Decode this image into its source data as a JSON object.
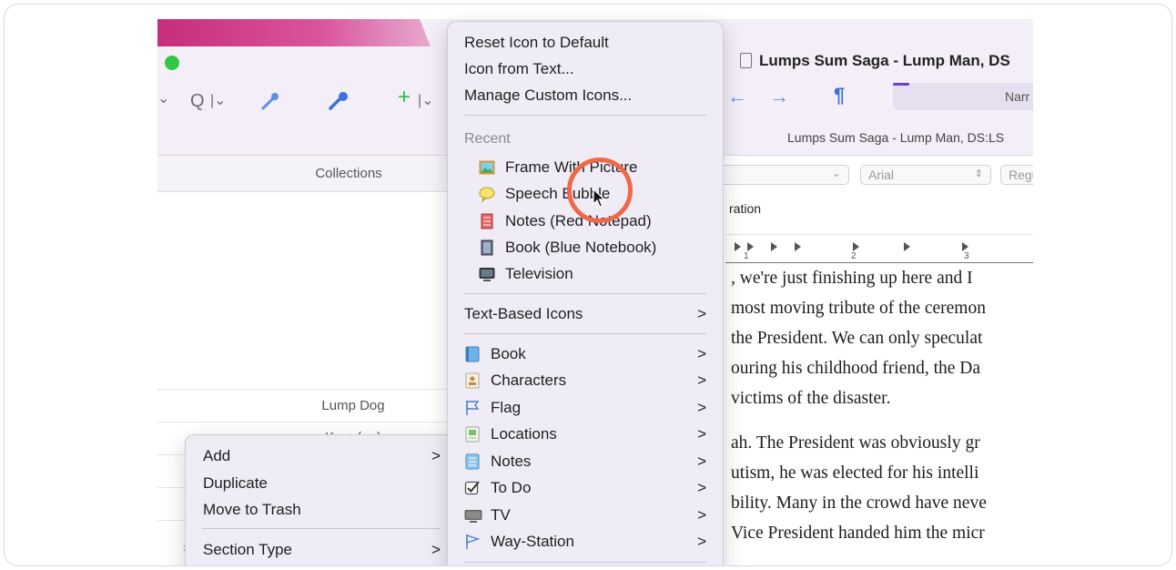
{
  "toolbar": {
    "collections_label": "Collections",
    "nav_back": "←",
    "nav_forward": "→",
    "pilcrow": "¶",
    "mode_pill": "Narr",
    "left_glyphs": {
      "chevron": "⌄",
      "search": "Q",
      "search_chevron": "|⌄",
      "add": "+",
      "add_chevron": "|⌄"
    }
  },
  "binder": {
    "rows": [
      "Lump Dog",
      "Keog(an)"
    ]
  },
  "editor": {
    "title": "Lumps Sum Saga - Lump Man, DS",
    "subtitle": "Lumps Sum Saga - Lump Man, DS:LS",
    "font_name": "Arial",
    "font_style": "Regu",
    "paragraph_style": "ration",
    "ruler_numbers": [
      "1",
      "2",
      "3"
    ],
    "body_lines": [
      ", we're just finishing up here and I",
      "most moving tribute of the ceremon",
      "the President. We can only speculat",
      "ouring his childhood friend, the Da",
      "victims of the disaster.",
      "ah. The President was obviously gr",
      "utism, he was elected for his intelli",
      "bility. Many in the crowd have neve",
      "Vice President handed him the micr"
    ]
  },
  "context_menu": {
    "items": [
      {
        "label": "Add",
        "submenu": true
      },
      {
        "label": "Duplicate",
        "submenu": false
      },
      {
        "label": "Move to Trash",
        "submenu": false
      },
      {
        "label": "Section Type",
        "submenu": true
      }
    ]
  },
  "icon_menu": {
    "top_items": [
      "Reset Icon to Default",
      "Icon from Text...",
      "Manage Custom Icons..."
    ],
    "recent_header": "Recent",
    "recent_items": [
      {
        "label": "Frame With Picture",
        "icon": "framed-picture-icon"
      },
      {
        "label": "Speech Bubble",
        "icon": "speech-bubble-icon"
      },
      {
        "label": "Notes (Red Notepad)",
        "icon": "red-notepad-icon"
      },
      {
        "label": "Book (Blue Notebook)",
        "icon": "blue-notebook-icon"
      },
      {
        "label": "Television",
        "icon": "television-icon"
      }
    ],
    "text_based": "Text-Based Icons",
    "category_items": [
      {
        "label": "Book",
        "icon": "book-icon"
      },
      {
        "label": "Characters",
        "icon": "characters-icon"
      },
      {
        "label": "Flag",
        "icon": "flag-icon"
      },
      {
        "label": "Locations",
        "icon": "locations-icon"
      },
      {
        "label": "Notes",
        "icon": "notes-icon"
      },
      {
        "label": "To Do",
        "icon": "checkbox-icon"
      },
      {
        "label": "TV",
        "icon": "tv-icon"
      },
      {
        "label": "Way-Station",
        "icon": "way-station-flag-icon"
      }
    ],
    "chevron": ">"
  },
  "colors": {
    "accent_blue": "#3a6fe0",
    "highlight_ring": "#f0684a",
    "window_green": "#33c748"
  }
}
